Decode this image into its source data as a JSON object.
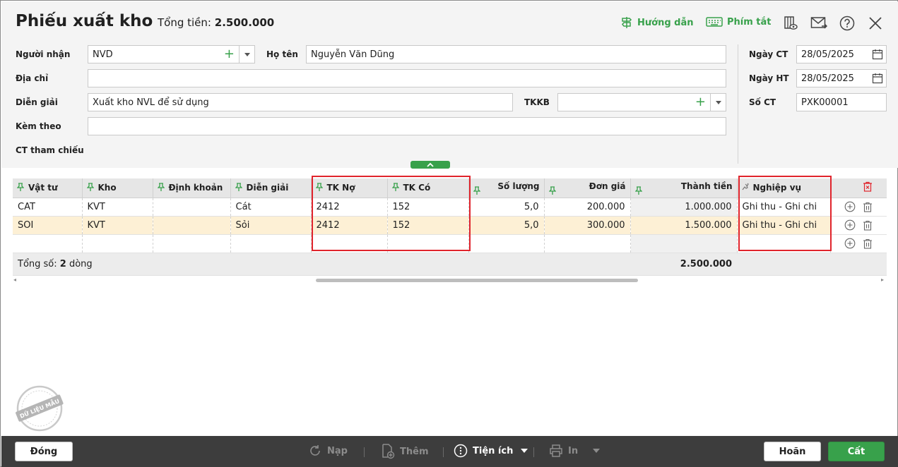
{
  "header": {
    "title": "Phiếu xuất kho",
    "total_label": "Tổng tiền:",
    "total_value": "2.500.000",
    "guide_label": "Hướng dẫn",
    "shortcut_label": "Phím tắt"
  },
  "form": {
    "receiver_label": "Người nhận",
    "receiver_value": "NVD",
    "fullname_label": "Họ tên",
    "fullname_value": "Nguyễn Văn Dũng",
    "address_label": "Địa chỉ",
    "address_value": "",
    "description_label": "Diễn giải",
    "description_value": "Xuất kho NVL để sử dụng",
    "tkkb_label": "TKKB",
    "tkkb_value": "",
    "attach_label": "Kèm theo",
    "attach_value": "",
    "ref_label": "CT tham chiếu",
    "ct_date_label": "Ngày CT",
    "ct_date_value": "28/05/2025",
    "ht_date_label": "Ngày HT",
    "ht_date_value": "28/05/2025",
    "doc_no_label": "Số CT",
    "doc_no_value": "PXK00001"
  },
  "grid": {
    "columns": [
      "Vật tư",
      "Kho",
      "Định khoản",
      "Diễn giải",
      "TK Nợ",
      "TK Có",
      "Số lượng",
      "Đơn giá",
      "Thành tiền",
      "Nghiệp vụ"
    ],
    "rows": [
      [
        "CAT",
        "KVT",
        "",
        "Cát",
        "2412",
        "152",
        "5,0",
        "200.000",
        "1.000.000",
        "Ghi thu - Ghi chi"
      ],
      [
        "SOI",
        "KVT",
        "",
        "Sỏi",
        "2412",
        "152",
        "5,0",
        "300.000",
        "1.500.000",
        "Ghi thu - Ghi chi"
      ]
    ],
    "footer_prefix": "Tổng số:",
    "footer_count": "2",
    "footer_suffix": "dòng",
    "footer_total": "2.500.000"
  },
  "stamp_text": "DỮ LIỆU MẪU",
  "footer": {
    "close_label": "Đóng",
    "reload_label": "Nạp",
    "add_label": "Thêm",
    "utility_label": "Tiện ích",
    "print_label": "In",
    "cancel_label": "Hoãn",
    "save_label": "Cất"
  },
  "colors": {
    "accent_green": "#38a14b",
    "highlight_red": "#e0242c",
    "selected_row": "#fdf0d5",
    "footer_bar": "#3d3d3d"
  }
}
